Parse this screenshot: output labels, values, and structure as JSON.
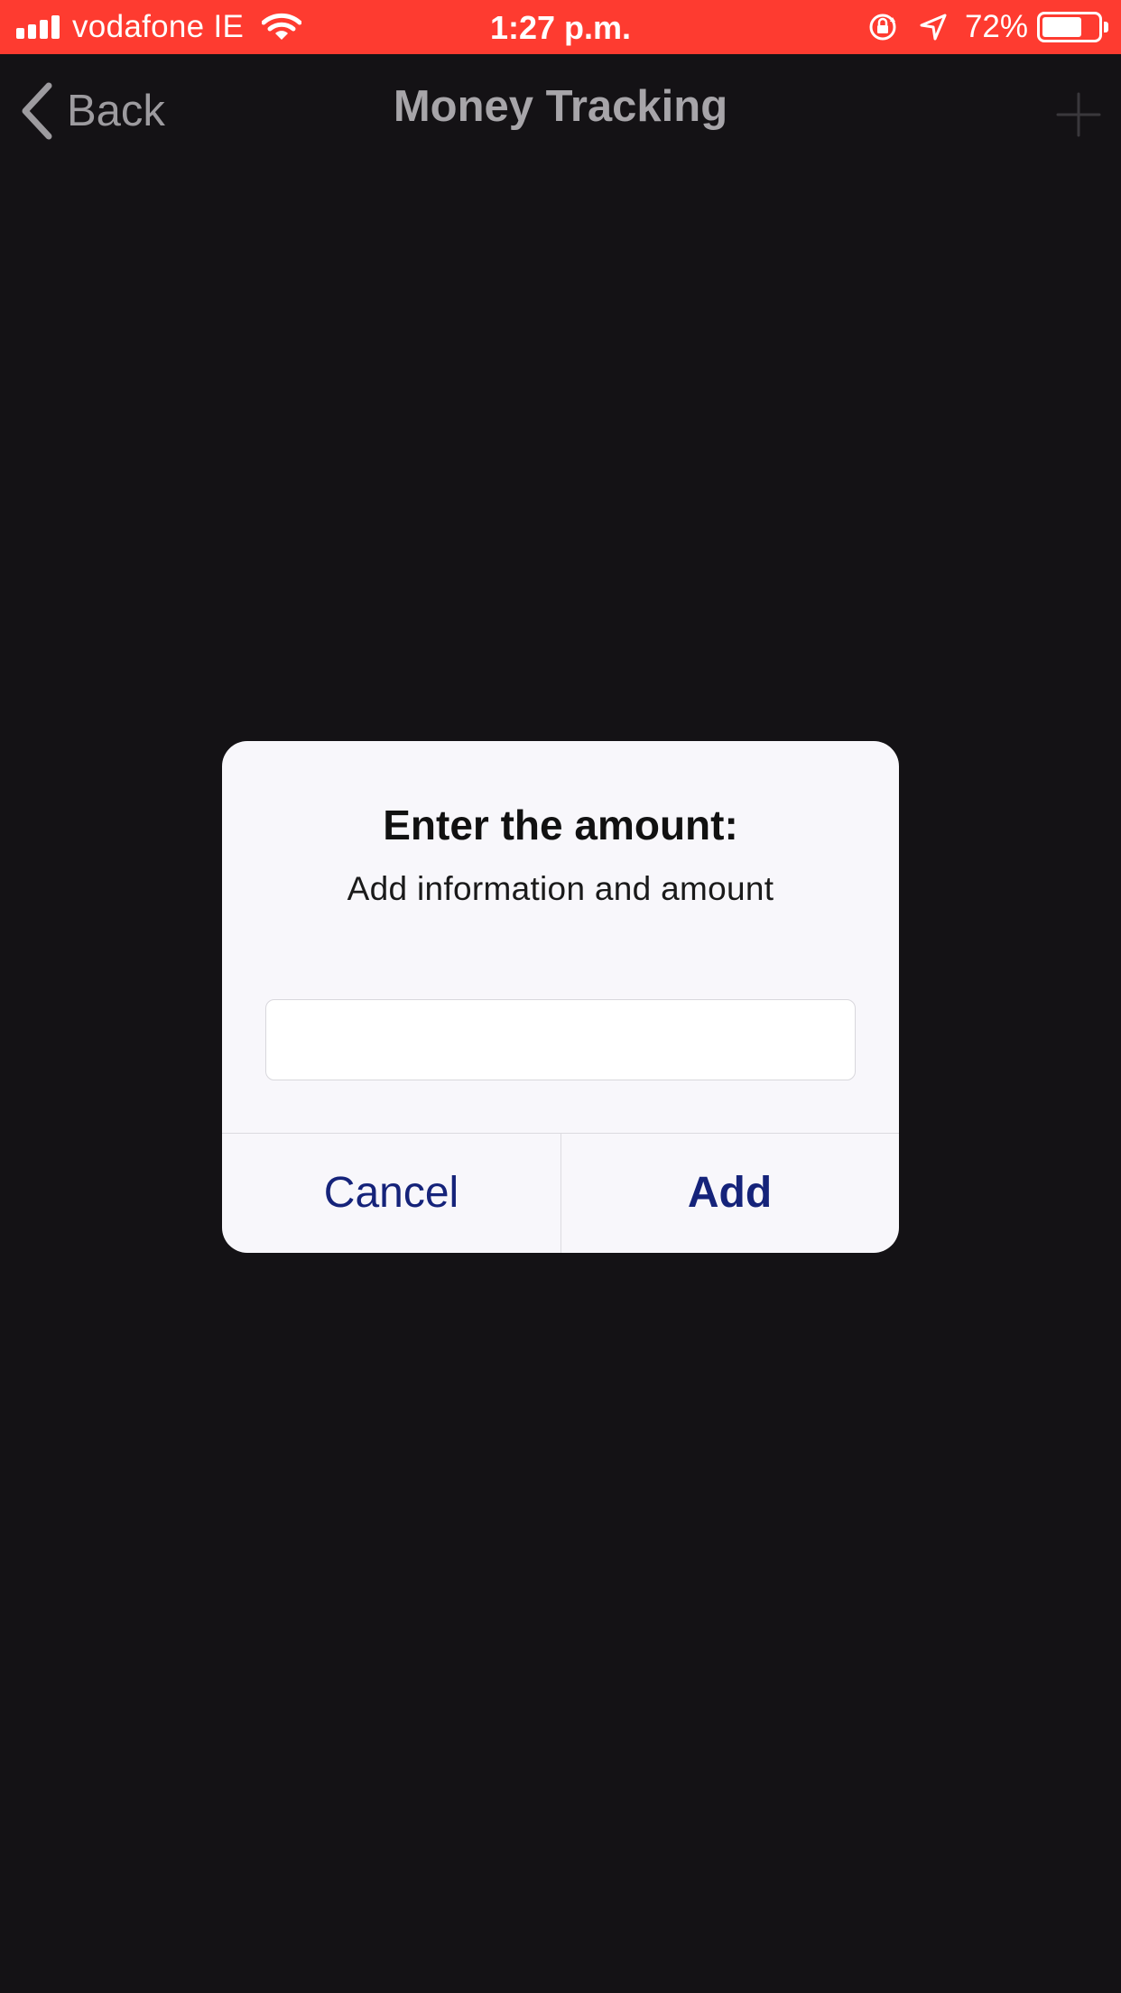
{
  "status_bar": {
    "carrier": "vodafone IE",
    "time": "1:27 p.m.",
    "battery_percent": "72%",
    "battery_level": 0.72,
    "icons": [
      "signal-icon",
      "wifi-icon",
      "orientation-lock-icon",
      "location-arrow-icon",
      "battery-icon"
    ],
    "background_color": "#fe3b30"
  },
  "nav": {
    "back_label": "Back",
    "title": "Money Tracking",
    "add_icon": "plus-icon"
  },
  "alert": {
    "title": "Enter the amount:",
    "message": "Add information and amount",
    "input_value": "",
    "input_placeholder": "",
    "cancel_label": "Cancel",
    "add_label": "Add",
    "button_color": "#15237a"
  },
  "colors": {
    "background": "#141215",
    "alert_background": "#f8f7fb"
  }
}
